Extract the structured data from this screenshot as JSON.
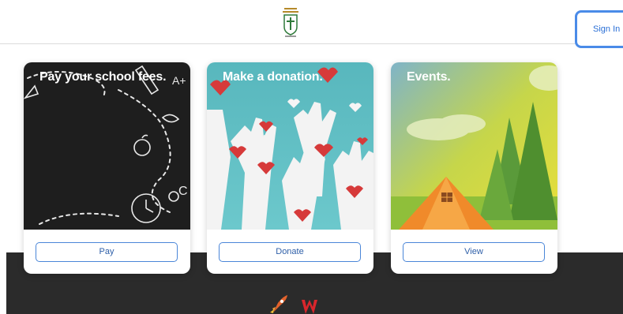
{
  "header": {
    "logo_icon": "school-crest-icon",
    "signin_label": "Sign In"
  },
  "cards": [
    {
      "title": "Pay your school fees.",
      "button_label": "Pay",
      "image": "chalkboard-illustration"
    },
    {
      "title": "Make a donation.",
      "button_label": "Donate",
      "image": "raised-hands-hearts-illustration"
    },
    {
      "title": "Events.",
      "button_label": "View",
      "image": "camping-tent-illustration"
    }
  ],
  "colors": {
    "accent": "#4a8be8",
    "footer": "#2b2b2b",
    "chalkboard": "#1e1e1e",
    "donation_bg": "#5fb8be",
    "heart": "#d63a3a"
  },
  "footer": {
    "icons": [
      "rocket-icon",
      "brand-w-icon"
    ]
  }
}
